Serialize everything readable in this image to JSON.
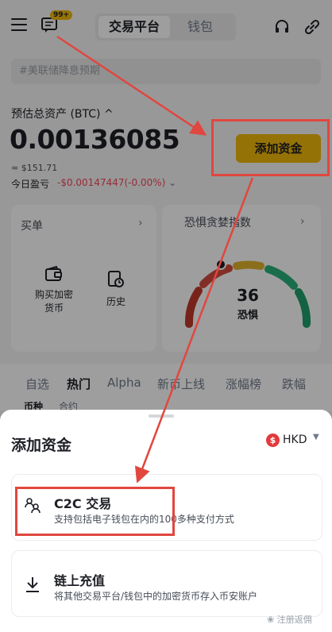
{
  "header": {
    "badge": "99+",
    "tabs": [
      {
        "label": "交易平台",
        "active": true
      },
      {
        "label": "钱包",
        "active": false
      }
    ]
  },
  "search": {
    "placeholder": "#美联储降息预期"
  },
  "assets": {
    "label": "预估总资产 (BTC)",
    "value": "0.00136085",
    "fiat": "≈ $151.71",
    "pnl_label": "今日盈亏",
    "pnl_value": "-$0.00147447(-0.00%)",
    "add_funds": "添加资金"
  },
  "buy_card": {
    "title": "买单",
    "actions": [
      {
        "label": "购买加密\n货币",
        "icon": "wallet-icon"
      },
      {
        "label": "历史",
        "icon": "history-icon"
      }
    ]
  },
  "fear_card": {
    "title": "恐惧贪婪指数",
    "value": "36",
    "label": "恐惧"
  },
  "market_tabs": [
    "自选",
    "热门",
    "Alpha",
    "新币上线",
    "涨幅榜",
    "跌幅"
  ],
  "market_subtabs": [
    "币种",
    "合约"
  ],
  "sheet": {
    "title": "添加资金",
    "currency": "HKD",
    "currency_symbol": "$",
    "options": [
      {
        "title": "C2C 交易",
        "subtitle": "支持包括电子钱包在内的100多种支付方式",
        "icon": "c2c-users-icon"
      },
      {
        "title": "链上充值",
        "subtitle": "将其他交易平台/钱包中的加密货币存入币安账户",
        "icon": "download-icon"
      }
    ]
  },
  "watermark": "注册返佣",
  "colors": {
    "accent": "#f0b90b",
    "negative": "#f6465d",
    "annotation": "#e0473f"
  }
}
